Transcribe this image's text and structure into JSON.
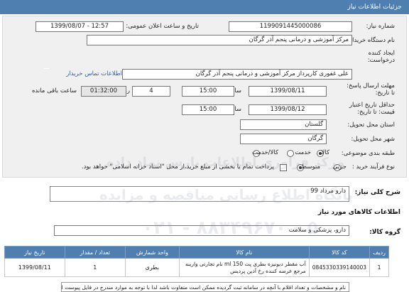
{
  "title": "جزئیات اطلاعات نیاز",
  "need_number": {
    "label": "شماره نیاز:",
    "value": "1199091445000086"
  },
  "announce": {
    "label": "تاریخ و ساعت اعلان عمومی:",
    "value": "1399/08/07 - 12:57"
  },
  "buyer": {
    "label": "نام دستگاه خریدار:",
    "value": "مرکز آموزشی و درمانی پنجم آذر گرگان"
  },
  "creator": {
    "label": "ایجاد کننده درخواست:",
    "value": "علی  غفوری کارپرداز مرکز آموزشی و درمانی پنجم آذر گرگان",
    "contact_link": "اطلاعات تماس خریدار"
  },
  "reply_deadline": {
    "label": "مهلت ارسال پاسخ:",
    "sub": "تا تاریخ:",
    "date": "1399/08/11",
    "time_label": "ساعت",
    "time": "15:00",
    "days": "4",
    "days_label": "روز و",
    "remaining": "01:32:00",
    "remaining_label": "ساعت باقی مانده"
  },
  "min_validity": {
    "label": "حداقل تاریخ اعتبار",
    "sub": "قیمت: تا تاریخ:",
    "date": "1399/08/12",
    "time_label": "ساعت",
    "time": "15:00"
  },
  "province": {
    "label": "استان محل تحویل:",
    "value": "گلستان"
  },
  "city": {
    "label": "شهر محل تحویل:",
    "value": "گرگان"
  },
  "category": {
    "label": "طبقه بندی موضوعی:",
    "options": [
      "کالا",
      "خدمت",
      "کالا/خدمت"
    ],
    "selected": "کالا"
  },
  "process": {
    "label": "نوع فرآیند خرید :",
    "options": [
      "جزیی",
      "متوسط"
    ],
    "selected": "متوسط",
    "payment_note": "پرداخت تمام یا بخشی از مبلغ خرید،از محل \"اسناد خزانه اسلامی\" خواهد بود."
  },
  "summary": {
    "label": "شرح کلی نیاز:",
    "value": "دارو مرداد 99"
  },
  "goods_info": {
    "label": "اطلاعات کالاهای مورد نیاز"
  },
  "goods_group": {
    "label": "گروه کالا:",
    "value": "دارو، پزشکی و سلامت"
  },
  "table": {
    "headers": [
      "ردیف",
      "کد کالا",
      "نام کالا",
      "واحد شمارش",
      "تعداد / مقدار",
      "تاریخ نیاز"
    ],
    "rows": [
      [
        "1",
        "0845330339140003",
        "آب مقطر دیونیزه بطری پت 150 ml نام تجارتی وارینه مرجع عرضه کننده رخ آذین پردیس",
        "بطری",
        "1",
        "1399/08/11"
      ]
    ]
  },
  "footer_note": "نام و مشخصات و تعداد اقلام با آنچه در سامانه ثبت گردیده ممکن است متفاوت باشد لذا با توجه به موارد مندرج در فایل پیوست اقدام نمایید",
  "watermark": {
    "line1": "مرکز فراوری اطلاعات پارس نماد داده",
    "line2": "پایگاه اطلاع رسانی مناقصه و مزایده",
    "line3": "۰۲۱ - ۸۸۳۴۹۶۷۰ - ۵"
  }
}
